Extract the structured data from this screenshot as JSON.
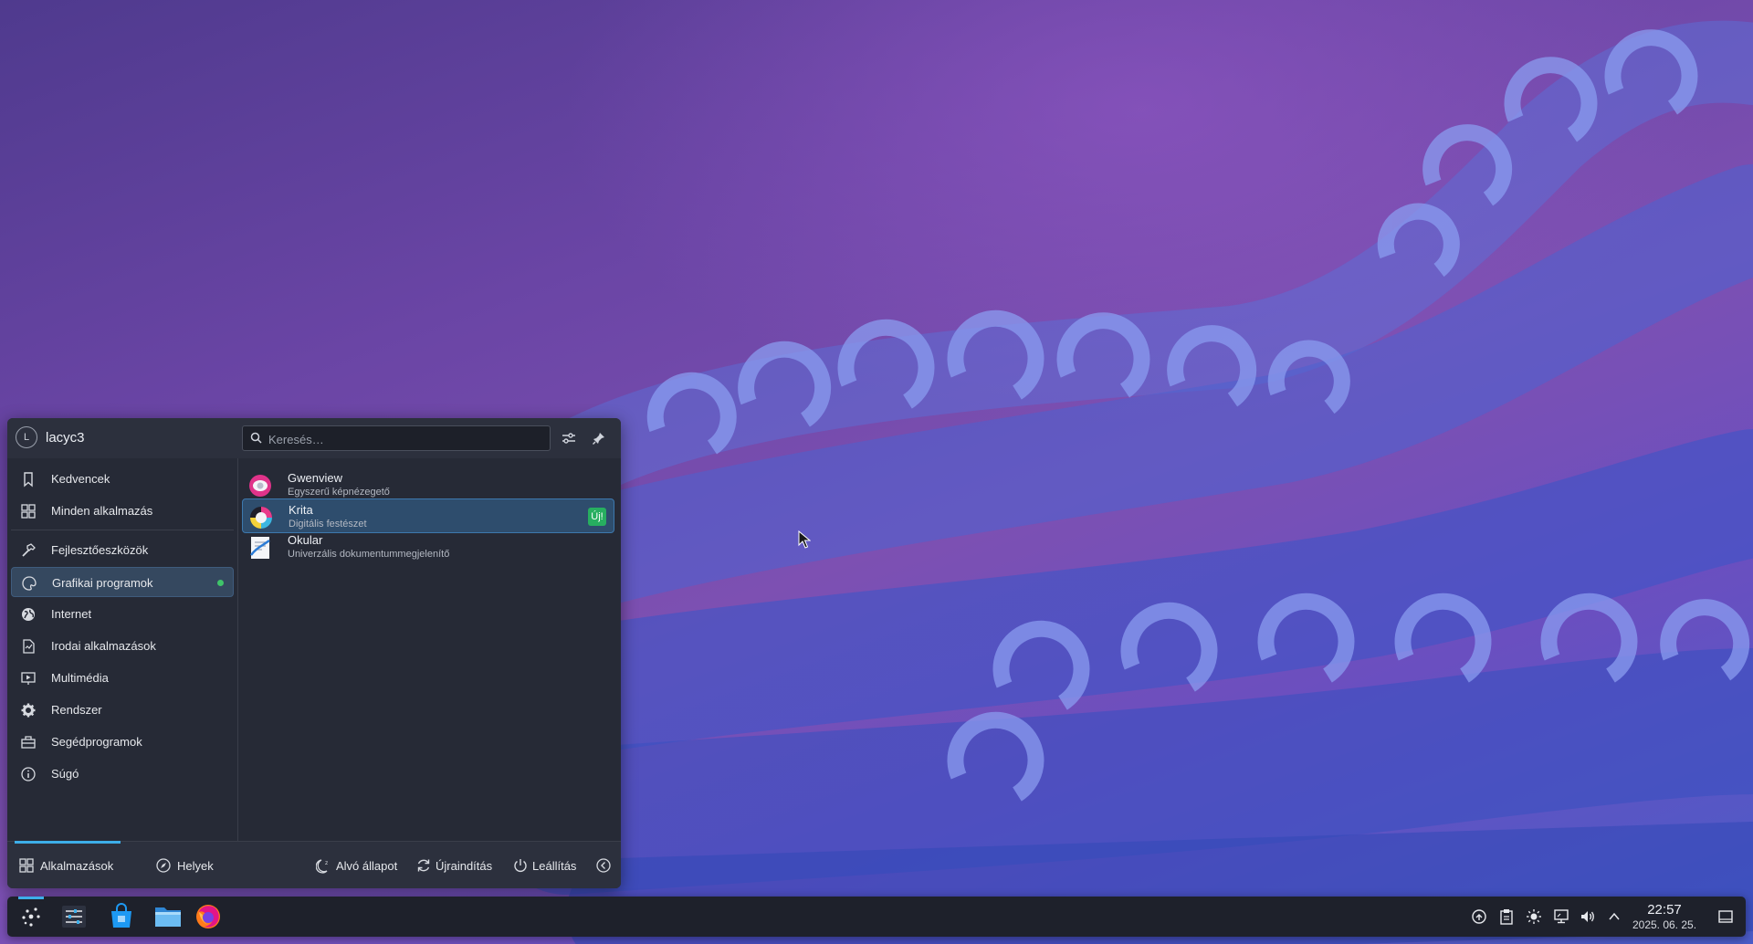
{
  "launcher": {
    "username": "lacyc3",
    "avatar_letter": "L",
    "search_placeholder": "Keresés…",
    "categories": [
      {
        "label": "Kedvencek",
        "icon": "bookmark-icon"
      },
      {
        "label": "Minden alkalmazás",
        "icon": "grid-icon"
      },
      {
        "label": "Fejlesztőeszközök",
        "icon": "hammer-icon"
      },
      {
        "label": "Grafikai programok",
        "icon": "graphics-icon",
        "active": true
      },
      {
        "label": "Internet",
        "icon": "globe-icon"
      },
      {
        "label": "Irodai alkalmazások",
        "icon": "document-icon"
      },
      {
        "label": "Multimédia",
        "icon": "multimedia-icon"
      },
      {
        "label": "Rendszer",
        "icon": "gear-icon"
      },
      {
        "label": "Segédprogramok",
        "icon": "toolbox-icon"
      },
      {
        "label": "Súgó",
        "icon": "info-icon"
      }
    ],
    "apps": [
      {
        "name": "Gwenview",
        "description": "Egyszerű képnézegető",
        "icon": "gwenview-icon"
      },
      {
        "name": "Krita",
        "description": "Digitális festészet",
        "icon": "krita-icon",
        "badge": "Új!",
        "selected": true
      },
      {
        "name": "Okular",
        "description": "Univerzális dokumentummegjelenítő",
        "icon": "okular-icon"
      }
    ],
    "footer": {
      "tab_apps": "Alkalmazások",
      "tab_places": "Helyek",
      "sleep": "Alvó állapot",
      "restart": "Újraindítás",
      "shutdown": "Leállítás"
    }
  },
  "taskbar": {
    "apps": [
      "app-launcher-icon",
      "system-settings-icon",
      "discover-store-icon",
      "file-manager-icon",
      "firefox-icon"
    ],
    "tray": [
      "network-icon",
      "clipboard-icon",
      "brightness-icon",
      "display-icon",
      "volume-icon",
      "expand-tray-icon"
    ],
    "time": "22:57",
    "date": "2025. 06. 25."
  },
  "colors": {
    "accent": "#3daee9",
    "new_badge": "#27ae60",
    "active_dot": "#3fc46a"
  }
}
